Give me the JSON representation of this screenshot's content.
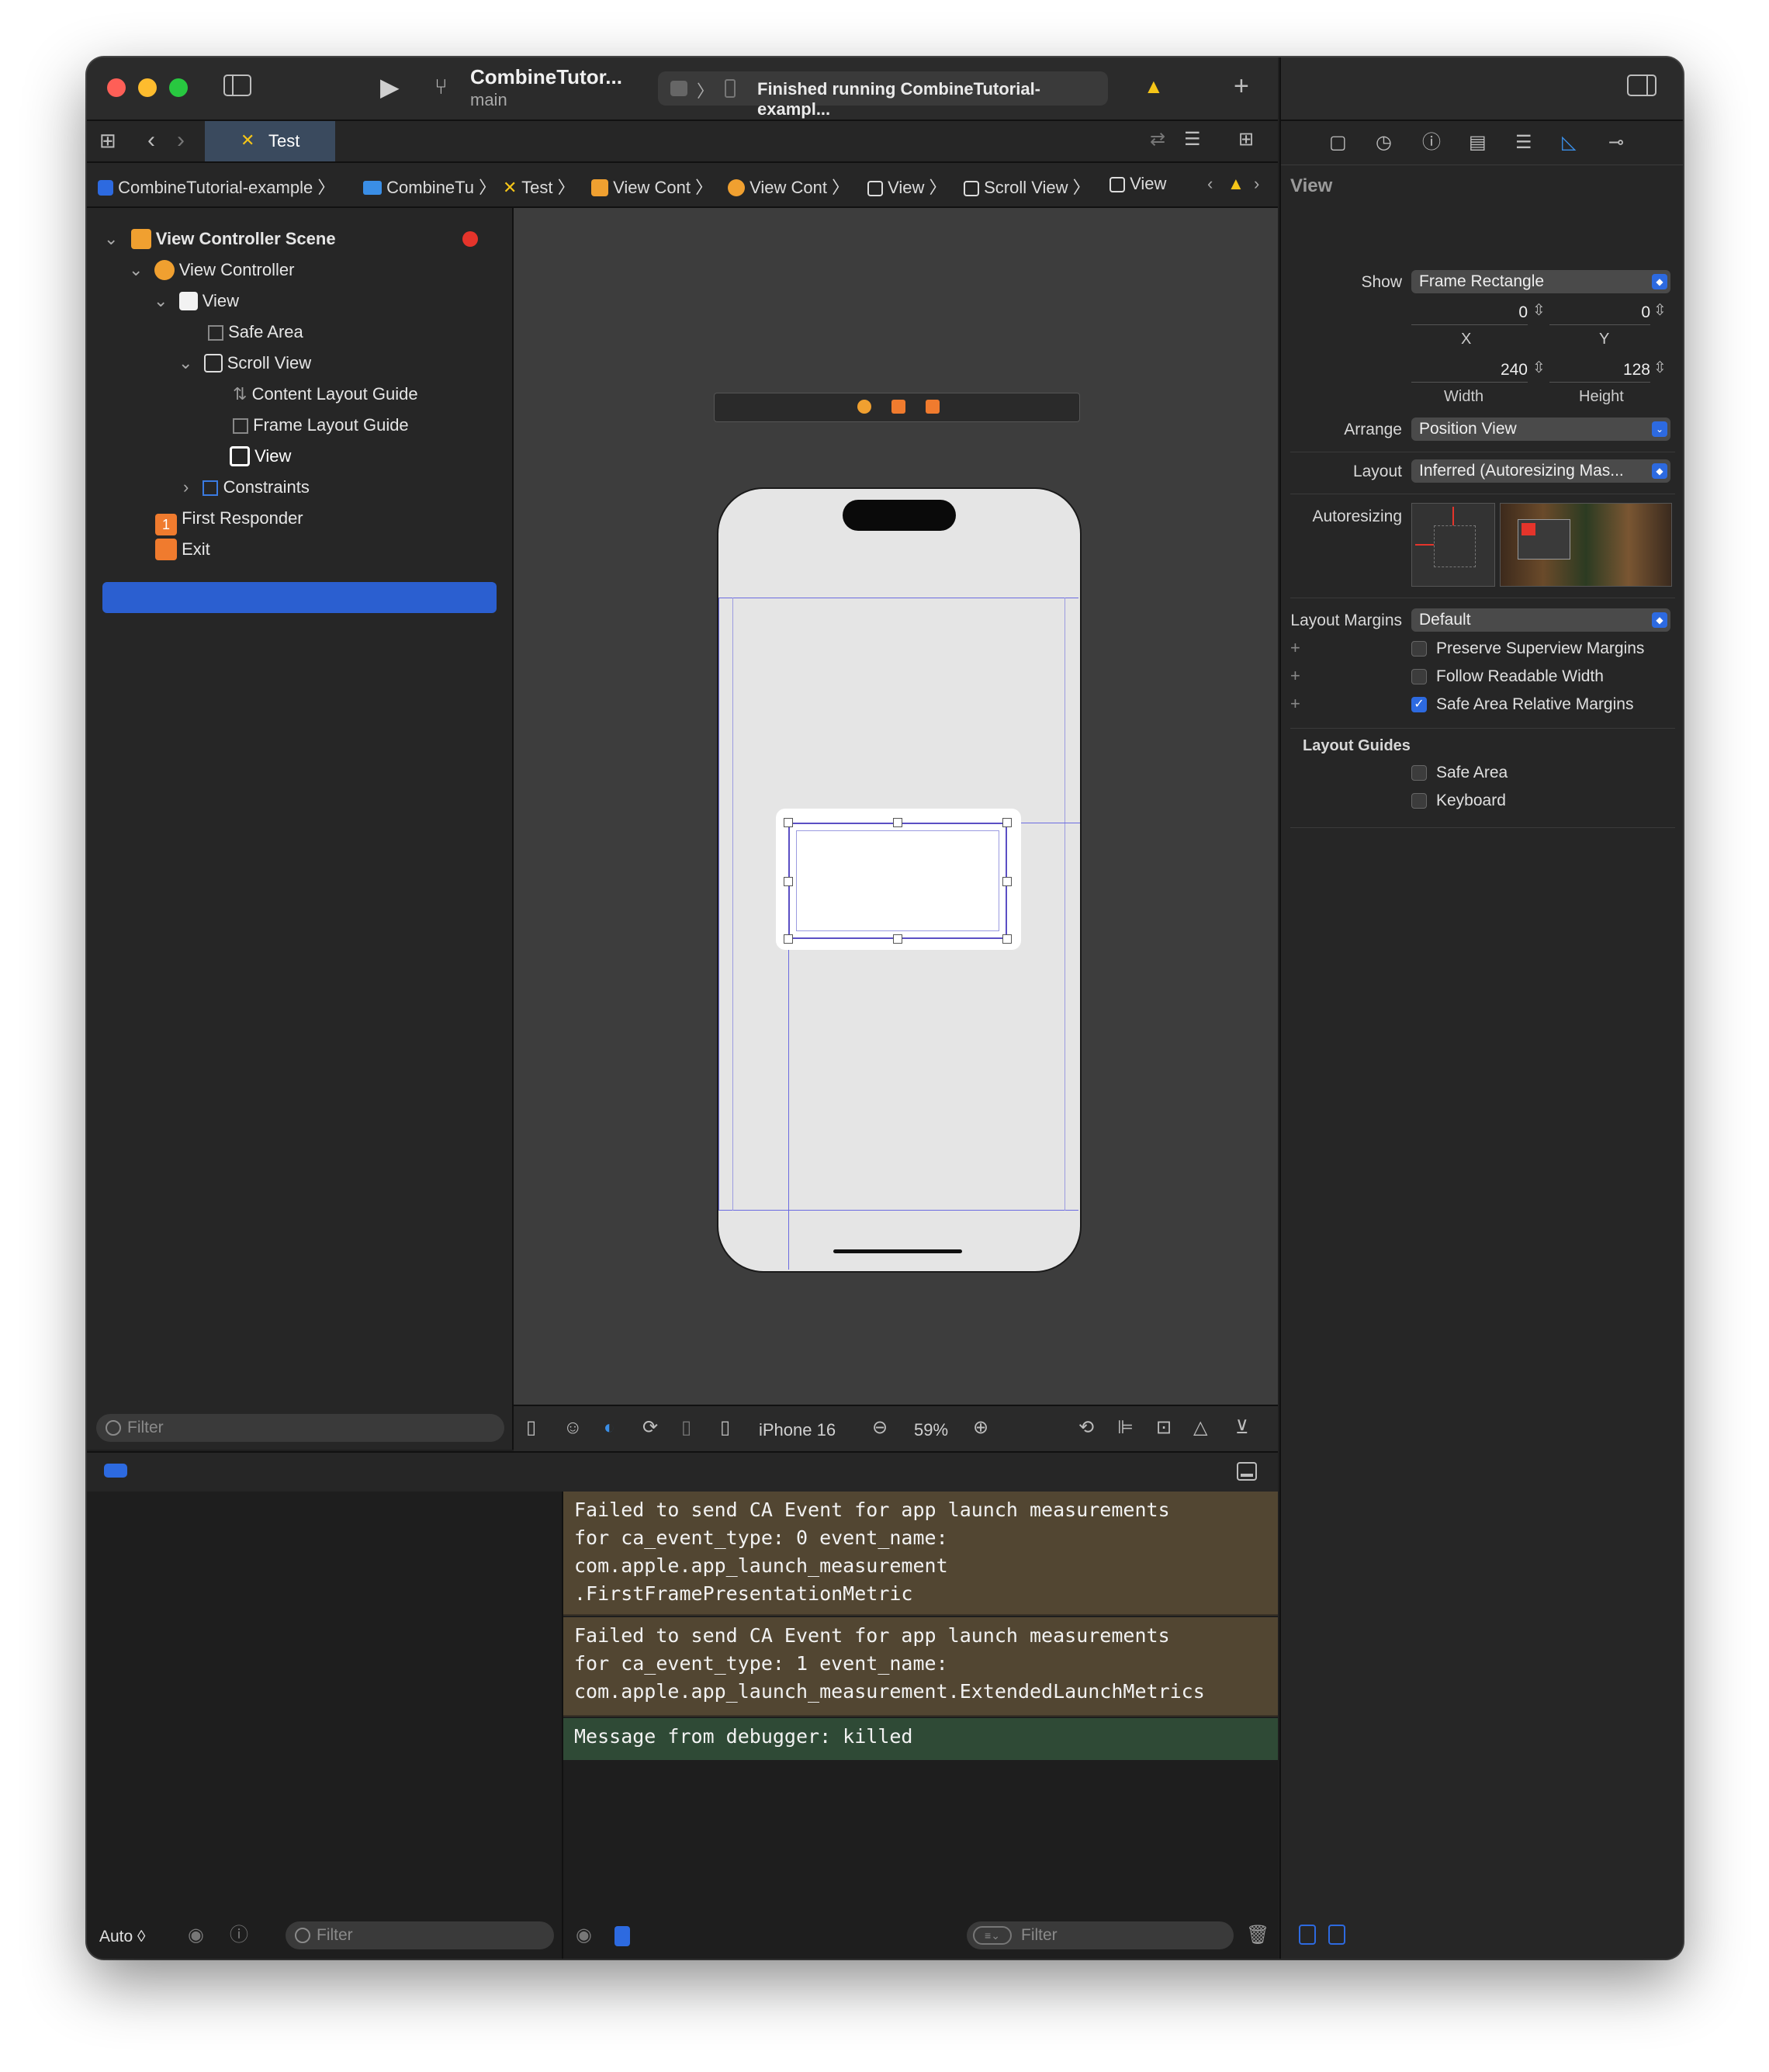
{
  "window": {
    "scheme_title": "CombineTutor...",
    "branch": "main",
    "status_text": "Finished running CombineTutorial-exampl..."
  },
  "tabs": [
    {
      "label": "Test"
    }
  ],
  "jumpbar": {
    "items": [
      "CombineTutorial-example",
      "CombineTu",
      "Test",
      "View Cont",
      "View Cont",
      "View",
      "Scroll View",
      "View"
    ]
  },
  "navigator": {
    "items": [
      {
        "label": "View Controller Scene"
      },
      {
        "label": "View Controller"
      },
      {
        "label": "View"
      },
      {
        "label": "Safe Area"
      },
      {
        "label": "Scroll View"
      },
      {
        "label": "Content Layout Guide"
      },
      {
        "label": "Frame Layout Guide"
      },
      {
        "label": "View"
      },
      {
        "label": "Constraints"
      },
      {
        "label": "First Responder"
      },
      {
        "label": "Exit"
      }
    ],
    "filter_placeholder": "Filter"
  },
  "canvas_bar": {
    "device": "iPhone 16",
    "zoom": "59%"
  },
  "inspector": {
    "title": "View",
    "show_label": "Show",
    "show_value": "Frame Rectangle",
    "x_value": "0",
    "y_value": "0",
    "x_label": "X",
    "y_label": "Y",
    "width_value": "240",
    "height_value": "128",
    "width_label": "Width",
    "height_label": "Height",
    "arrange_label": "Arrange",
    "arrange_value": "Position View",
    "layout_label": "Layout",
    "layout_value": "Inferred (Autoresizing Mas...",
    "autoresizing_label": "Autoresizing",
    "layout_margins_label": "Layout Margins",
    "layout_margins_value": "Default",
    "checkboxes": [
      {
        "label": "Preserve Superview Margins",
        "checked": false
      },
      {
        "label": "Follow Readable Width",
        "checked": false
      },
      {
        "label": "Safe Area Relative Margins",
        "checked": true
      }
    ],
    "layout_guides_title": "Layout Guides",
    "guides": [
      {
        "label": "Safe Area",
        "checked": false
      },
      {
        "label": "Keyboard",
        "checked": false
      }
    ]
  },
  "debug": {
    "auto_label": "Auto ◊",
    "vars_filter_placeholder": "Filter",
    "console_filter_placeholder": "Filter"
  },
  "console": {
    "messages": [
      {
        "text": "Failed to send CA Event for app launch measurements\nfor ca_event_type: 0 event_name:\ncom.apple.app_launch_measurement\n.FirstFramePresentationMetric",
        "kind": "warning"
      },
      {
        "text": "Failed to send CA Event for app launch measurements\nfor ca_event_type: 1 event_name:\ncom.apple.app_launch_measurement.ExtendedLaunchMetrics",
        "kind": "warning"
      },
      {
        "text": "Message from debugger: killed",
        "kind": "info"
      }
    ]
  },
  "colors": {
    "accent": "#2d6ae0",
    "selection": "#2b5fd0",
    "warning_bg": "#524632",
    "info_bg": "#2f4a36"
  }
}
